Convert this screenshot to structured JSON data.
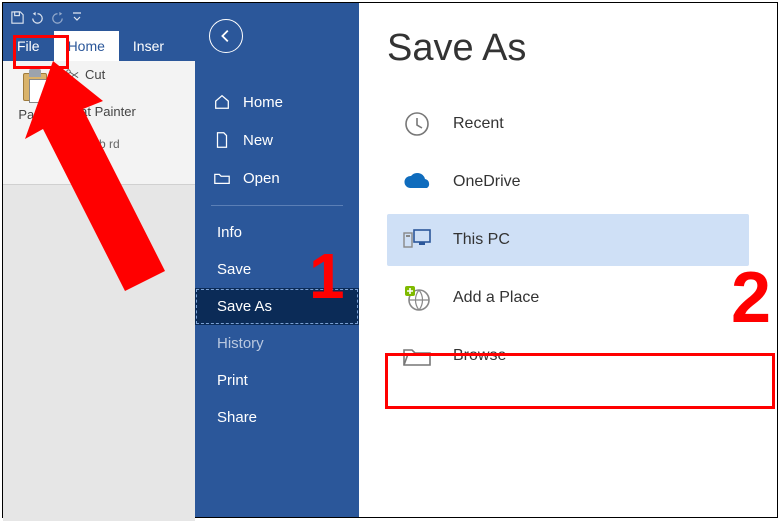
{
  "titlebar": {
    "qat": {
      "save": "save-icon",
      "undo": "undo-icon",
      "redo": "redo-icon",
      "more": "dropdown-icon"
    }
  },
  "tabs": {
    "file": "File",
    "home": "Home",
    "insert": "Inser"
  },
  "ribbon": {
    "paste_label": "Paste",
    "cut_label": "Cut",
    "format_painter_label": "rmat Painter",
    "group_label": "Clipb        rd"
  },
  "backstage": {
    "nav": {
      "home": "Home",
      "new": "New",
      "open": "Open",
      "info": "Info",
      "save": "Save",
      "save_as": "Save As",
      "history": "History",
      "print": "Print",
      "share": "Share"
    },
    "title": "Save As",
    "locations": {
      "recent": "Recent",
      "onedrive": "OneDrive",
      "this_pc": "This PC",
      "add_place": "Add a Place",
      "browse": "Browse"
    }
  },
  "annotations": {
    "step1": "1",
    "step2": "2"
  }
}
